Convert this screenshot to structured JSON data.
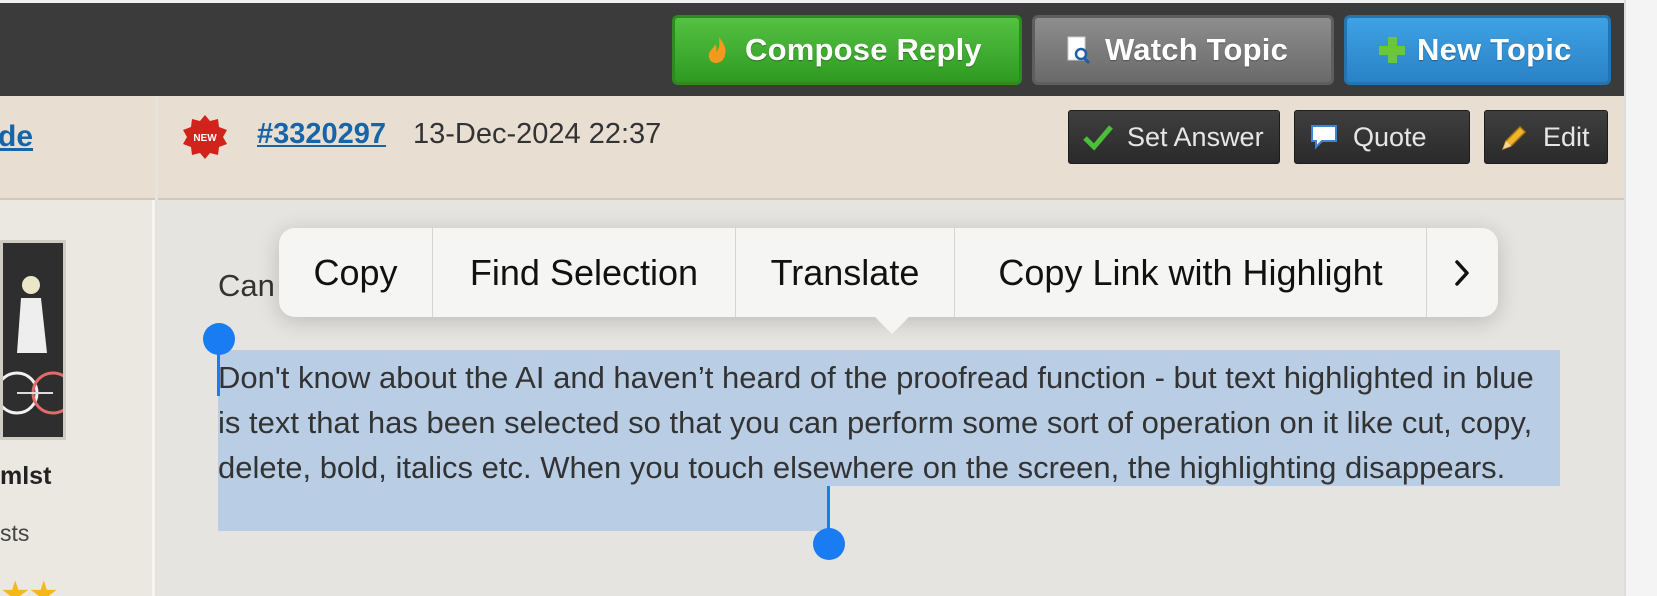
{
  "toolbar": {
    "compose_label": "Compose Reply",
    "watch_label": "Watch Topic",
    "new_label": "New Topic"
  },
  "author": {
    "link_text": "de",
    "name": "mlst",
    "posts_label": "sts",
    "stars": "★★"
  },
  "post": {
    "badge": "NEW",
    "number": "#3320297",
    "date": "13-Dec-2024 22:37",
    "set_answer_label": "Set Answer",
    "quote_label": "Quote",
    "edit_label": "Edit",
    "partial_line": "Can",
    "selected_text": "Don't know about the AI and haven’t heard of the proofread function - but text highlighted in blue is text that has been selected so that you can perform some sort of operation on it like cut, copy, delete, bold, italics etc. When you touch elsewhere on the screen, the highlighting disappears."
  },
  "context_menu": {
    "items": [
      "Copy",
      "Find Selection",
      "Translate",
      "Copy Link with Highlight"
    ],
    "more_glyph": "›"
  },
  "colors": {
    "selection": "#b9cee5",
    "handle": "#1a7cf2",
    "compose": "#3fae2f",
    "watch": "#7a7a7a",
    "new": "#2f8ed6"
  }
}
